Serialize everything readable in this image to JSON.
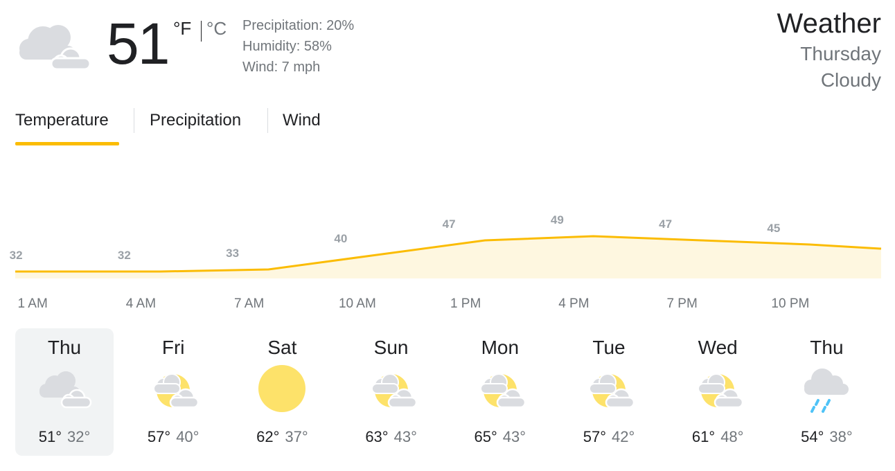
{
  "current": {
    "temp": "51",
    "unit_f": "°F",
    "unit_c": "°C",
    "precipitation": "Precipitation: 20%",
    "humidity": "Humidity: 58%",
    "wind": "Wind: 7 mph",
    "icon": "cloudy-icon"
  },
  "header": {
    "title": "Weather",
    "day": "Thursday",
    "condition": "Cloudy"
  },
  "tabs": [
    {
      "label": "Temperature",
      "active": true
    },
    {
      "label": "Precipitation",
      "active": false
    },
    {
      "label": "Wind",
      "active": false
    }
  ],
  "colors": {
    "accent": "#fbbc04",
    "fill": "#fef7e0",
    "sun": "#fde26a",
    "cloud": "#dadce0",
    "rain": "#4fc3f7"
  },
  "chart_data": {
    "type": "area",
    "x": [
      "1 AM",
      "4 AM",
      "7 AM",
      "10 AM",
      "1 PM",
      "4 PM",
      "7 PM",
      "10 PM"
    ],
    "values": [
      32,
      32,
      33,
      40,
      47,
      49,
      47,
      45
    ],
    "series": [
      {
        "values": [
          32,
          32,
          33,
          40,
          47,
          49,
          47,
          45
        ]
      }
    ],
    "unit": "°F"
  },
  "hours": [
    "1 AM",
    "4 AM",
    "7 AM",
    "10 AM",
    "1 PM",
    "4 PM",
    "7 PM",
    "10 PM"
  ],
  "forecast": [
    {
      "day": "Thu",
      "hi": "51°",
      "lo": "32°",
      "icon": "cloudy-icon",
      "selected": true
    },
    {
      "day": "Fri",
      "hi": "57°",
      "lo": "40°",
      "icon": "partly-cloudy-icon",
      "selected": false
    },
    {
      "day": "Sat",
      "hi": "62°",
      "lo": "37°",
      "icon": "sunny-icon",
      "selected": false
    },
    {
      "day": "Sun",
      "hi": "63°",
      "lo": "43°",
      "icon": "partly-cloudy-icon",
      "selected": false
    },
    {
      "day": "Mon",
      "hi": "65°",
      "lo": "43°",
      "icon": "partly-cloudy-icon",
      "selected": false
    },
    {
      "day": "Tue",
      "hi": "57°",
      "lo": "42°",
      "icon": "partly-cloudy-icon",
      "selected": false
    },
    {
      "day": "Wed",
      "hi": "61°",
      "lo": "48°",
      "icon": "partly-cloudy-icon",
      "selected": false
    },
    {
      "day": "Thu",
      "hi": "54°",
      "lo": "38°",
      "icon": "rain-icon",
      "selected": false
    }
  ]
}
